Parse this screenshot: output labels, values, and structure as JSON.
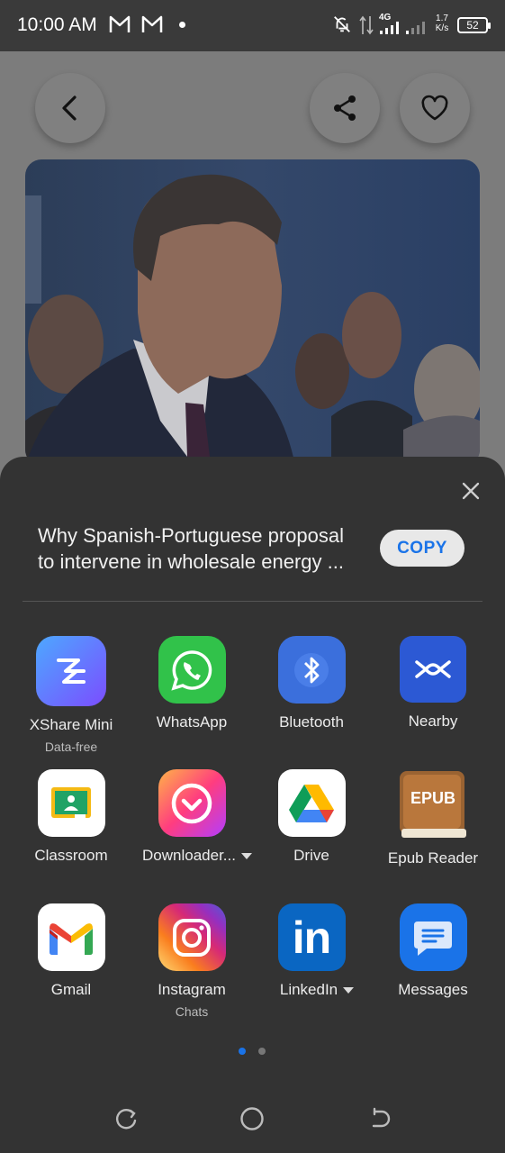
{
  "status_bar": {
    "time": "10:00 AM",
    "network_label": "4G",
    "net_speed_value": "1.7",
    "net_speed_unit": "K/s",
    "battery": "52",
    "icons": [
      "gmail-m-icon",
      "gmail-m-icon",
      "dot-icon",
      "bell-off-icon",
      "data-arrows-icon",
      "signal-icon",
      "signal-icon",
      "battery-icon"
    ]
  },
  "article": {
    "back_icon": "chevron-left-icon",
    "share_icon": "share-icon",
    "favorite_icon": "heart-icon"
  },
  "share_sheet": {
    "title_line1": "Why Spanish-Portuguese proposal",
    "title_line2": "to intervene in wholesale energy ...",
    "copy_label": "COPY",
    "close_icon": "close-icon",
    "apps": [
      {
        "label": "XShare Mini",
        "sub": "Data-free",
        "icon": "xshare-icon",
        "color": "#6a6cf0"
      },
      {
        "label": "WhatsApp",
        "sub": "",
        "icon": "whatsapp-icon",
        "color": "#2ecc40"
      },
      {
        "label": "Bluetooth",
        "sub": "",
        "icon": "bluetooth-icon",
        "color": "#3d6fd9"
      },
      {
        "label": "Nearby",
        "sub": "",
        "icon": "nearby-icon",
        "color": "#2b5bd6"
      },
      {
        "label": "Classroom",
        "sub": "",
        "icon": "classroom-icon",
        "color": "#ffffff"
      },
      {
        "label": "Downloader...",
        "sub": "",
        "icon": "downloader-icon",
        "color": "#ff4d7e",
        "dropdown": true
      },
      {
        "label": "Drive",
        "sub": "",
        "icon": "drive-icon",
        "color": "#ffffff"
      },
      {
        "label": "Epub Reader",
        "sub": "",
        "icon": "epub-icon",
        "color": "#8b5a2b",
        "badge": "EPUB"
      },
      {
        "label": "Gmail",
        "sub": "",
        "icon": "gmail-icon",
        "color": "#ffffff"
      },
      {
        "label": "Instagram",
        "sub": "Chats",
        "icon": "instagram-icon",
        "color": "#d62976"
      },
      {
        "label": "LinkedIn",
        "sub": "",
        "icon": "linkedin-icon",
        "color": "#0a66c2",
        "dropdown": true,
        "badge": "in"
      },
      {
        "label": "Messages",
        "sub": "",
        "icon": "messages-icon",
        "color": "#1a73e8"
      }
    ],
    "pages": {
      "current": 1,
      "total": 2
    }
  },
  "navbar": {
    "icons": [
      "recent-apps-icon",
      "home-icon",
      "back-icon"
    ]
  },
  "colors": {
    "accent": "#1a73e8",
    "sheet_bg": "#333333"
  }
}
